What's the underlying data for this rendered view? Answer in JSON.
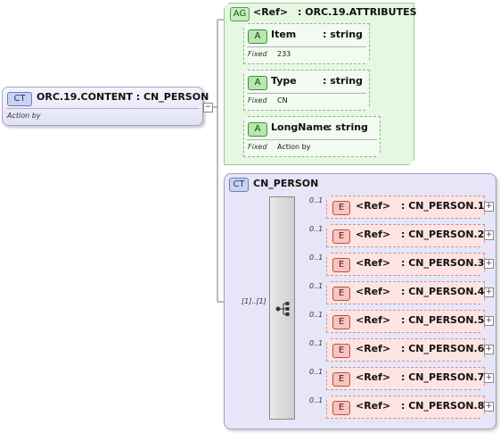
{
  "root": {
    "badge": "CT",
    "name": "ORC.19.CONTENT : CN_PERSON",
    "annotation": "Action by"
  },
  "attribute_group": {
    "badge": "AG",
    "ref": "<Ref>",
    "name": ": ORC.19.ATTRIBUTES",
    "attributes": [
      {
        "badge": "A",
        "name": "Item",
        "type": ": string",
        "fixed_label": "Fixed",
        "fixed_value": "233"
      },
      {
        "badge": "A",
        "name": "Type",
        "type": ": string",
        "fixed_label": "Fixed",
        "fixed_value": "CN"
      },
      {
        "badge": "A",
        "name": "LongName",
        "type": ": string",
        "fixed_label": "Fixed",
        "fixed_value": "Action by"
      }
    ]
  },
  "complex_type": {
    "badge": "CT",
    "name": "CN_PERSON",
    "sequence_cardinality": "[1]..[1]",
    "sequence_icon": "sequence-icon",
    "elements": [
      {
        "badge": "E",
        "ref": "<Ref>",
        "name": ": CN_PERSON.1",
        "cardinality": "0..1"
      },
      {
        "badge": "E",
        "ref": "<Ref>",
        "name": ": CN_PERSON.2",
        "cardinality": "0..1"
      },
      {
        "badge": "E",
        "ref": "<Ref>",
        "name": ": CN_PERSON.3",
        "cardinality": "0..1"
      },
      {
        "badge": "E",
        "ref": "<Ref>",
        "name": ": CN_PERSON.4",
        "cardinality": "0..1"
      },
      {
        "badge": "E",
        "ref": "<Ref>",
        "name": ": CN_PERSON.5",
        "cardinality": "0..1"
      },
      {
        "badge": "E",
        "ref": "<Ref>",
        "name": ": CN_PERSON.6",
        "cardinality": "0..1"
      },
      {
        "badge": "E",
        "ref": "<Ref>",
        "name": ": CN_PERSON.7",
        "cardinality": "0..1"
      },
      {
        "badge": "E",
        "ref": "<Ref>",
        "name": ": CN_PERSON.8",
        "cardinality": "0..1"
      }
    ]
  },
  "colors": {
    "complex_type_bg": "#e6e6f8",
    "attribute_group_bg": "#e6f8e2",
    "element_bg": "#fde4e2"
  }
}
